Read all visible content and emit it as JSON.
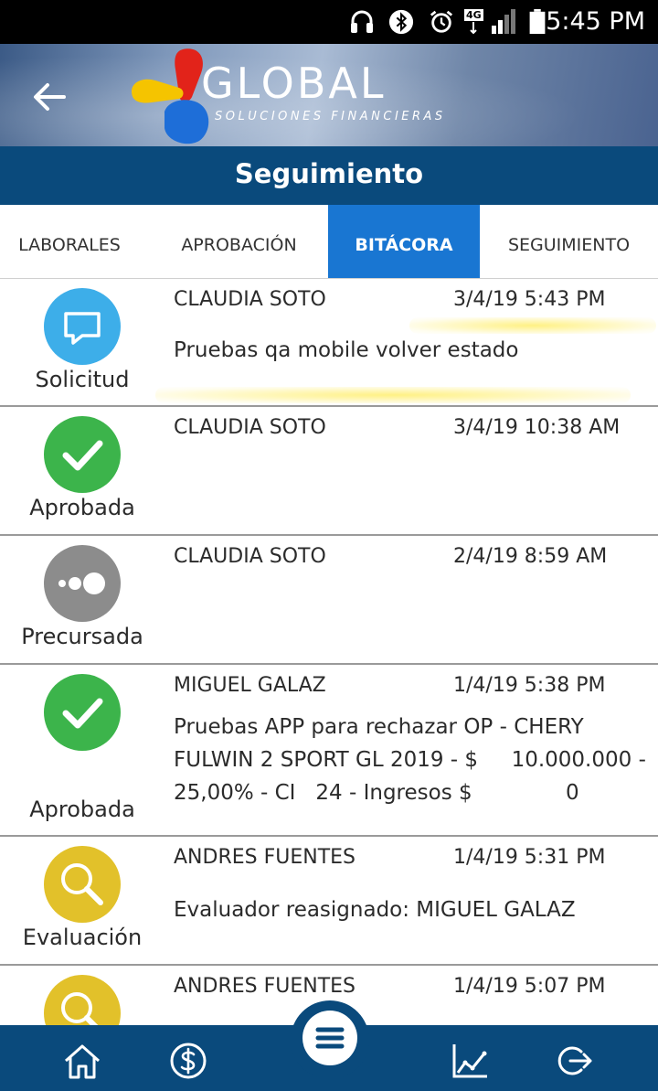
{
  "status_bar": {
    "time": "5:45 PM",
    "network": "4G"
  },
  "header": {
    "logo_text": "GLOBAL",
    "logo_subtitle": "SOLUCIONES FINANCIERAS",
    "title": "Seguimiento"
  },
  "tabs": [
    {
      "label": "LABORALES",
      "active": false
    },
    {
      "label": "APROBACIÓN",
      "active": false
    },
    {
      "label": "BITÁCORA",
      "active": true
    },
    {
      "label": "SEGUIMIENTO",
      "active": false
    }
  ],
  "entries": [
    {
      "status": "Solicitud",
      "icon": "chat-bubble-icon",
      "color": "#3daee9",
      "author": "CLAUDIA SOTO",
      "date": "3/4/19 5:43 PM",
      "comment": "Pruebas qa mobile volver estado"
    },
    {
      "status": "Aprobada",
      "icon": "check-icon",
      "color": "#3cb44b",
      "author": "CLAUDIA SOTO",
      "date": "3/4/19 10:38 AM",
      "comment": ""
    },
    {
      "status": "Precursada",
      "icon": "more-dots-icon",
      "color": "#8c8c8c",
      "author": "CLAUDIA SOTO",
      "date": "2/4/19 8:59 AM",
      "comment": ""
    },
    {
      "status": "Aprobada",
      "icon": "check-icon",
      "color": "#3cb44b",
      "author": "MIGUEL GALAZ",
      "date": "1/4/19 5:38 PM",
      "comment": "Pruebas APP para rechazar OP - CHERY FULWIN 2 SPORT GL 2019 - $     10.000.000 - 25,00% - CI   24 - Ingresos $              0"
    },
    {
      "status": "Evaluación",
      "icon": "magnifier-icon",
      "color": "#e2c12a",
      "author": "ANDRES FUENTES",
      "date": "1/4/19 5:31 PM",
      "comment": "Evaluador reasignado: MIGUEL GALAZ"
    },
    {
      "status": "",
      "icon": "magnifier-icon",
      "color": "#e2c12a",
      "author": "ANDRES FUENTES",
      "date": "1/4/19 5:07 PM",
      "comment": ""
    }
  ],
  "bottom_nav": [
    "home-icon",
    "dollar-icon",
    "menu-icon",
    "chart-icon",
    "logout-icon"
  ]
}
